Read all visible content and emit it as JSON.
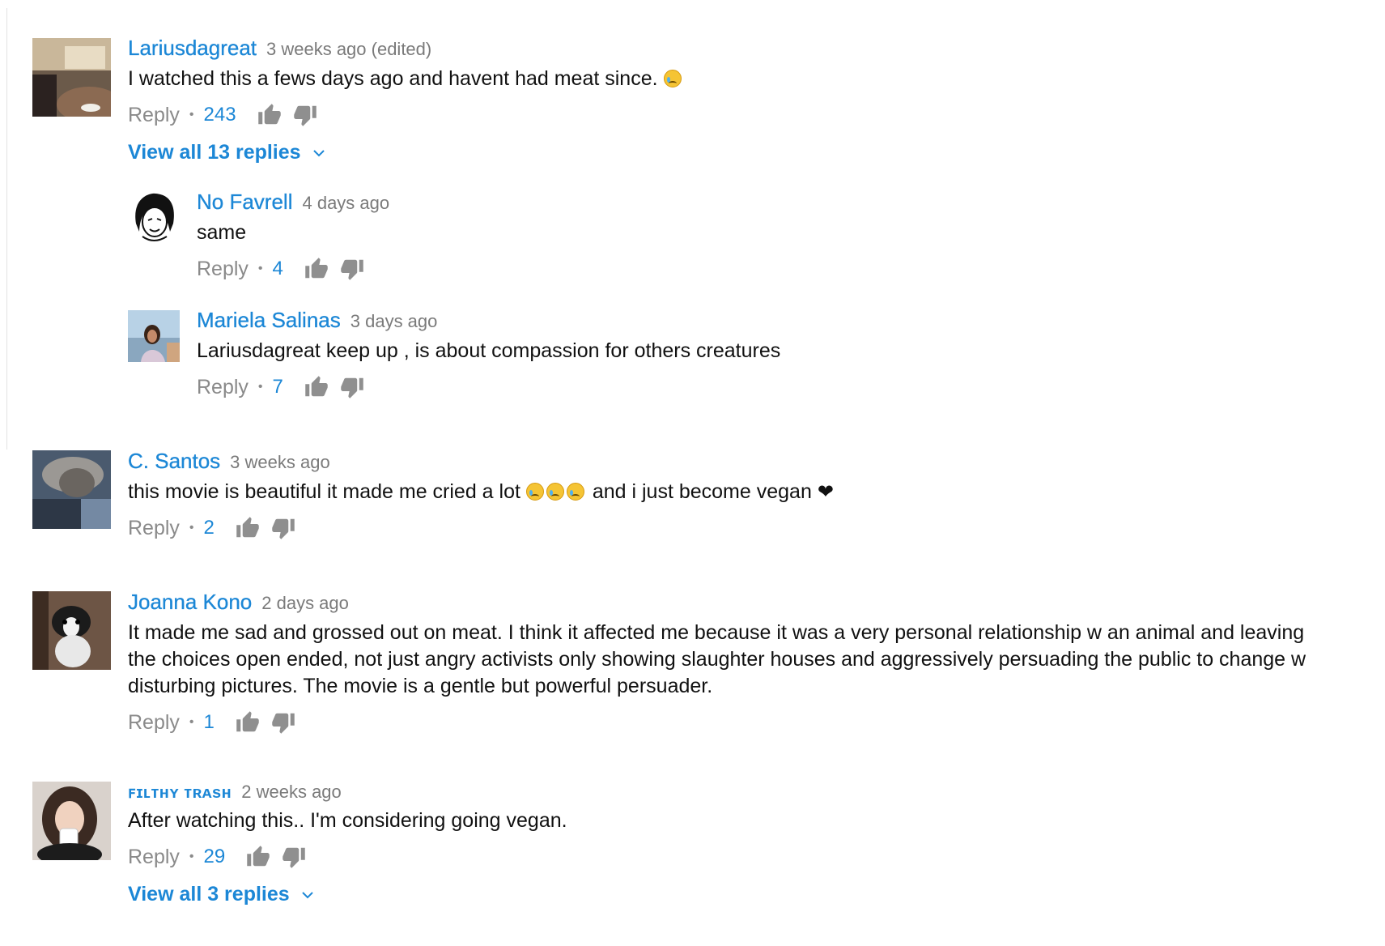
{
  "comments": [
    {
      "author": "Lariusdagreat",
      "time": "3 weeks ago (edited)",
      "text": "I watched this a fews days ago and havent had meat since.",
      "emoji": [
        "loudly-crying-face"
      ],
      "reply_label": "Reply",
      "likes": "243",
      "view_replies": "View all 13 replies",
      "avatar": "man-face-photo",
      "replies": [
        {
          "author": "No Favrell",
          "time": "4 days ago",
          "text": "same",
          "reply_label": "Reply",
          "likes": "4",
          "avatar": "anime-face-drawing"
        },
        {
          "author": "Mariela Salinas",
          "time": "3 days ago",
          "text": "Lariusdagreat keep up , is about compassion for others creatures",
          "reply_label": "Reply",
          "likes": "7",
          "avatar": "woman-outdoor-photo"
        }
      ]
    },
    {
      "author": "C. Santos",
      "time": "3 weeks ago",
      "text_before": "this movie is beautiful it made me cried a lot",
      "text_after": "and i just become vegan",
      "emoji": [
        "crying-face",
        "crying-face",
        "crying-face",
        "black-heart"
      ],
      "reply_label": "Reply",
      "likes": "2",
      "avatar": "profile-photo"
    },
    {
      "author": "Joanna Kono",
      "time": "2 days ago",
      "text": "It made me sad and grossed out on meat. I think it affected me because it was a very personal relationship w an animal and leaving the choices open ended, not just angry activists only showing slaughter houses and aggressively persuading the public to change w disturbing pictures. The movie is a gentle but powerful persuader.",
      "reply_label": "Reply",
      "likes": "1",
      "avatar": "dog-photo"
    },
    {
      "author": "ꜰɪʟᴛʜʏ ᴛʀᴀsʜ",
      "time": "2 weeks ago",
      "text": "After watching this.. I'm considering going vegan.",
      "reply_label": "Reply",
      "likes": "29",
      "view_replies": "View all 3 replies",
      "avatar": "woman-drinking-photo"
    }
  ],
  "colors": {
    "link": "#1c87d6",
    "meta": "#7a7a7a",
    "text": "#111111",
    "icon": "#8f8f8f"
  }
}
